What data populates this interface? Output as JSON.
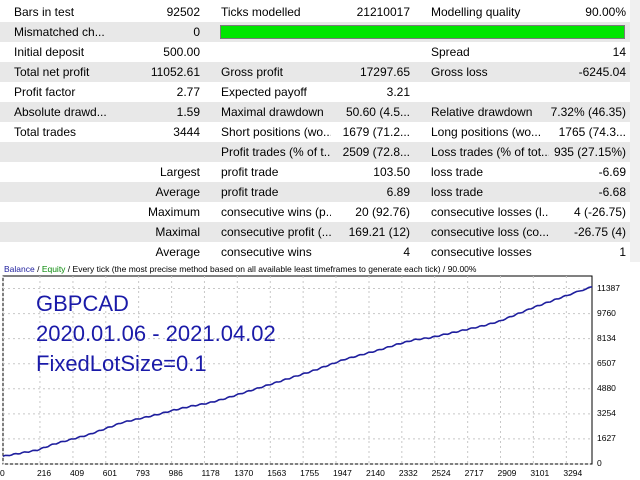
{
  "report": {
    "rows": [
      {
        "c1l": "Bars in test",
        "c1v": "92502",
        "c2l": "Ticks modelled",
        "c2v": "21210017",
        "c3l": "Modelling quality",
        "c3v": "90.00%"
      },
      {
        "c1l": "Mismatched ch...",
        "c1v": "0",
        "c2l": "",
        "c2v": "",
        "c3l": "",
        "c3v": ""
      },
      {
        "c1l": "Initial deposit",
        "c1v": "500.00",
        "c2l": "",
        "c2v": "",
        "c3l": "Spread",
        "c3v": "14"
      },
      {
        "c1l": "Total net profit",
        "c1v": "11052.61",
        "c2l": "Gross profit",
        "c2v": "17297.65",
        "c3l": "Gross loss",
        "c3v": "-6245.04"
      },
      {
        "c1l": "Profit factor",
        "c1v": "2.77",
        "c2l": "Expected payoff",
        "c2v": "3.21",
        "c3l": "",
        "c3v": ""
      },
      {
        "c1l": "Absolute drawd...",
        "c1v": "1.59",
        "c2l": "Maximal drawdown",
        "c2v": "50.60 (4.5...",
        "c3l": "Relative drawdown",
        "c3v": "7.32% (46.35)"
      },
      {
        "c1l": "Total trades",
        "c1v": "3444",
        "c2l": "Short positions (wo...",
        "c2v": "1679 (71.2...",
        "c3l": "Long positions (wo...",
        "c3v": "1765 (74.3..."
      },
      {
        "c1l": "",
        "c1v": "",
        "c2l": "Profit trades (% of t...",
        "c2v": "2509 (72.8...",
        "c3l": "Loss trades (% of tot...",
        "c3v": "935 (27.15%)"
      },
      {
        "c1l": "",
        "c1v": "Largest",
        "c2l": "profit trade",
        "c2v": "103.50",
        "c3l": "loss trade",
        "c3v": "-6.69"
      },
      {
        "c1l": "",
        "c1v": "Average",
        "c2l": "profit trade",
        "c2v": "6.89",
        "c3l": "loss trade",
        "c3v": "-6.68"
      },
      {
        "c1l": "",
        "c1v": "Maximum",
        "c2l": "consecutive wins (p...",
        "c2v": "20 (92.76)",
        "c3l": "consecutive losses (l...",
        "c3v": "4 (-26.75)"
      },
      {
        "c1l": "",
        "c1v": "Maximal",
        "c2l": "consecutive profit (...",
        "c2v": "169.21 (12)",
        "c3l": "consecutive loss (co...",
        "c3v": "-26.75 (4)"
      },
      {
        "c1l": "",
        "c1v": "Average",
        "c2l": "consecutive wins",
        "c2v": "4",
        "c3l": "consecutive losses",
        "c3v": "1"
      }
    ],
    "quality_bar_fill": 1.0,
    "quality_bar_color": "#00e600"
  },
  "chart": {
    "header": {
      "balance": "Balance",
      "sep": " / ",
      "equity": "Equity",
      "rest": " / Every tick (the most precise method based on all available least timeframes to generate each tick) / 90.00%"
    },
    "overlay": {
      "line1": "GBPCAD",
      "line2": "2020.01.06 - 2021.04.02",
      "line3": "FixedLotSize=0.1"
    },
    "colors": {
      "balance": "#1f1f9e",
      "equity": "#0a8a0a",
      "grid": "#c8c8c8",
      "overlay": "#1a1aa8"
    }
  },
  "chart_data": {
    "type": "line",
    "title": "",
    "xlabel": "",
    "ylabel": "",
    "x_ticks": [
      "0",
      "216",
      "409",
      "601",
      "793",
      "986",
      "1178",
      "1370",
      "1563",
      "1755",
      "1947",
      "2140",
      "2332",
      "2524",
      "2717",
      "2909",
      "3101",
      "3294"
    ],
    "y_ticks": [
      "11387",
      "9760",
      "8134",
      "6507",
      "4880",
      "3254",
      "1627",
      "0"
    ],
    "xlim": [
      0,
      3444
    ],
    "ylim": [
      0,
      12200
    ],
    "series": [
      {
        "name": "Balance",
        "x": [
          0,
          100,
          200,
          300,
          400,
          500,
          600,
          700,
          800,
          900,
          1000,
          1100,
          1200,
          1300,
          1400,
          1500,
          1600,
          1700,
          1800,
          1900,
          2000,
          2100,
          2200,
          2300,
          2400,
          2500,
          2600,
          2700,
          2800,
          2900,
          3000,
          3100,
          3200,
          3300,
          3444
        ],
        "y": [
          500,
          700,
          900,
          1300,
          1600,
          1900,
          2300,
          2700,
          2950,
          3200,
          3500,
          3750,
          3950,
          4250,
          4600,
          4950,
          5300,
          5650,
          6000,
          6400,
          6800,
          7100,
          7400,
          7750,
          8050,
          8200,
          8450,
          8700,
          8950,
          9250,
          9700,
          10150,
          10550,
          10950,
          11500
        ]
      }
    ]
  }
}
